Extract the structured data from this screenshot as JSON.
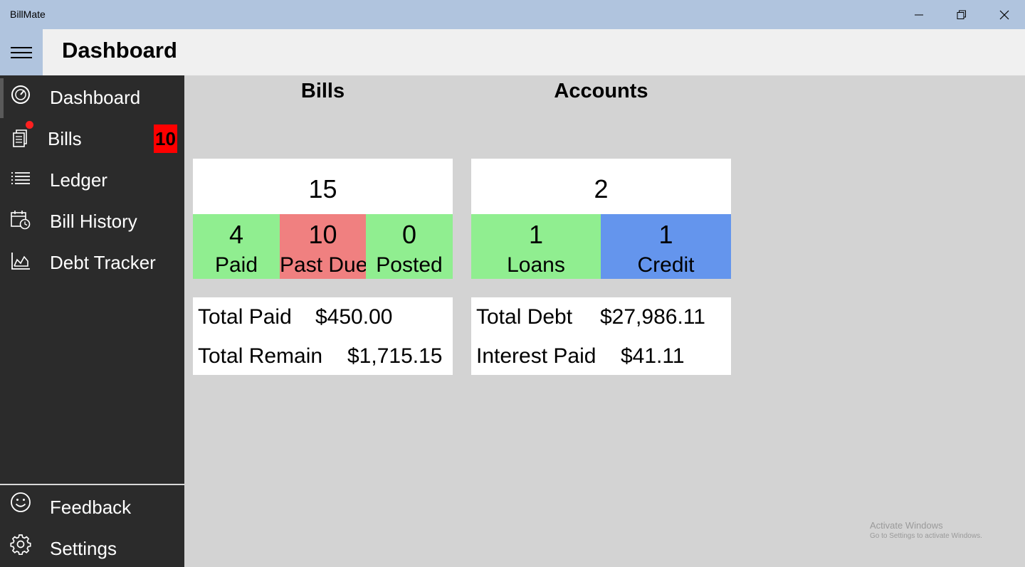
{
  "window": {
    "title": "BillMate",
    "minimize_icon": "minimize-icon",
    "restore_icon": "restore-icon",
    "close_icon": "close-icon"
  },
  "header": {
    "menu_icon": "hamburger-icon",
    "page_title": "Dashboard"
  },
  "sidebar": {
    "items": [
      {
        "label": "Dashboard",
        "icon": "gauge-icon",
        "active": true
      },
      {
        "label": "Bills",
        "icon": "bills-icon",
        "badge": "10"
      },
      {
        "label": "Ledger",
        "icon": "list-icon"
      },
      {
        "label": "Bill History",
        "icon": "calendar-clock-icon"
      },
      {
        "label": "Debt Tracker",
        "icon": "area-chart-icon"
      }
    ],
    "footer_items": [
      {
        "label": "Feedback",
        "icon": "smiley-icon"
      },
      {
        "label": "Settings",
        "icon": "gear-icon"
      }
    ]
  },
  "bills": {
    "heading": "Bills",
    "total": "15",
    "tiles": [
      {
        "value": "4",
        "label": "Paid",
        "color": "#90ee90"
      },
      {
        "value": "10",
        "label": "Past Due",
        "color": "#f08080"
      },
      {
        "value": "0",
        "label": "Posted",
        "color": "#90ee90"
      }
    ],
    "summary": {
      "total_paid_label": "Total Paid",
      "total_paid_value": "$450.00",
      "total_remain_label": "Total Remain",
      "total_remain_value": "$1,715.15"
    }
  },
  "accounts": {
    "heading": "Accounts",
    "total": "2",
    "tiles": [
      {
        "value": "1",
        "label": "Loans",
        "color": "#90ee90"
      },
      {
        "value": "1",
        "label": "Credit",
        "color": "#6495ed"
      }
    ],
    "summary": {
      "total_debt_label": "Total Debt",
      "total_debt_value": "$27,986.11",
      "interest_paid_label": "Interest Paid",
      "interest_paid_value": "$41.11"
    }
  },
  "watermark": {
    "line1": "Activate Windows",
    "line2": "Go to Settings to activate Windows."
  },
  "colors": {
    "titlebar": "#b0c4de",
    "sidebar": "#2b2b2b",
    "content_bg": "#d3d3d3",
    "badge": "#ff0000"
  }
}
